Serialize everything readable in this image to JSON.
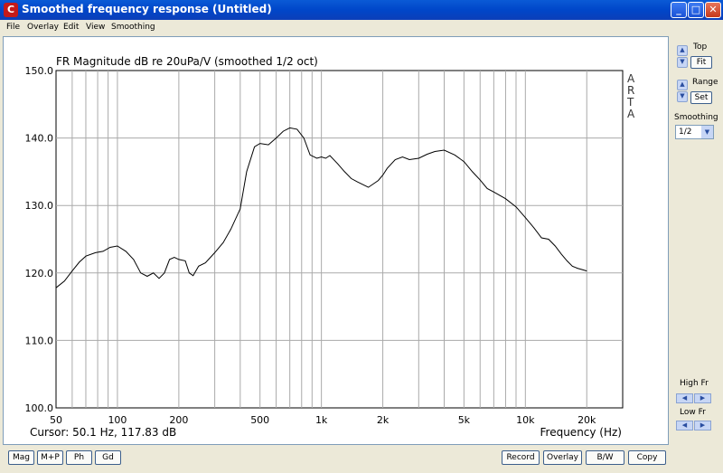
{
  "window": {
    "title": "Smoothed frequency response (Untitled)",
    "app_icon": "C",
    "minimize": "_",
    "maximize": "□",
    "close": "✕"
  },
  "menu": [
    "File",
    "Overlay",
    "Edit",
    "View",
    "Smoothing"
  ],
  "side_panel": {
    "top_label": "Top",
    "fit_label": "Fit",
    "range_label": "Range",
    "set_label": "Set",
    "smoothing_label": "Smoothing",
    "smoothing_value": "1/2",
    "high_fr_label": "High Fr",
    "low_fr_label": "Low Fr"
  },
  "bottom_left_buttons": [
    "Mag",
    "M+P",
    "Ph",
    "Gd"
  ],
  "bottom_right_buttons": [
    "Record",
    "Overlay",
    "B/W",
    "Copy"
  ],
  "colors": {
    "curve": "#000000",
    "grid": "#aaaaaa",
    "plot_bg": "#ffffff"
  },
  "chart_data": {
    "type": "line",
    "title": "FR Magnitude dB re 20uPa/V (smoothed 1/2 oct)",
    "watermark": "ARTA",
    "xlabel": "Frequency (Hz)",
    "x_scale": "log",
    "xlim": [
      50,
      30000
    ],
    "ylim": [
      100,
      150
    ],
    "yticks": [
      100,
      110,
      120,
      130,
      140,
      150
    ],
    "ytick_labels": [
      "100.0",
      "110.0",
      "120.0",
      "130.0",
      "140.0",
      "150.0"
    ],
    "xticks": [
      50,
      100,
      200,
      500,
      1000,
      2000,
      5000,
      10000,
      20000
    ],
    "xtick_labels": [
      "50",
      "100",
      "200",
      "500",
      "1k",
      "2k",
      "5k",
      "10k",
      "20k"
    ],
    "cursor_text": "Cursor: 50.1 Hz, 117.83 dB",
    "grid": true,
    "series": [
      {
        "x": [
          50,
          55,
          60,
          65,
          70,
          78,
          85,
          92,
          100,
          110,
          120,
          130,
          140,
          150,
          160,
          170,
          180,
          190,
          200,
          215,
          225,
          235,
          250,
          270,
          300,
          330,
          360,
          400,
          430,
          470,
          500,
          550,
          600,
          650,
          700,
          760,
          820,
          880,
          950,
          1000,
          1050,
          1100,
          1200,
          1300,
          1400,
          1500,
          1700,
          1900,
          2000,
          2100,
          2300,
          2500,
          2700,
          3000,
          3300,
          3600,
          4000,
          4500,
          5000,
          5500,
          6000,
          6500,
          7000,
          8000,
          9000,
          10000,
          11000,
          12000,
          13000,
          14000,
          15000,
          16000,
          17000,
          18000,
          19000,
          20000
        ],
        "y": [
          117.8,
          118.8,
          120.3,
          121.6,
          122.5,
          123.0,
          123.2,
          123.8,
          124.0,
          123.2,
          122.0,
          120.0,
          119.5,
          120.0,
          119.2,
          120.0,
          122.0,
          122.3,
          122.0,
          121.8,
          120.0,
          119.6,
          121.0,
          121.5,
          123.0,
          124.5,
          126.5,
          129.5,
          135.0,
          138.7,
          139.2,
          139.0,
          140.0,
          141.0,
          141.5,
          141.3,
          140.0,
          137.5,
          137.0,
          137.2,
          137.0,
          137.4,
          136.2,
          135.0,
          134.0,
          133.5,
          132.7,
          133.7,
          134.5,
          135.5,
          136.8,
          137.2,
          136.8,
          137.0,
          137.6,
          138.0,
          138.2,
          137.5,
          136.5,
          135.0,
          133.8,
          132.5,
          132.0,
          131.0,
          129.8,
          128.2,
          126.7,
          125.2,
          125.0,
          124.0,
          122.8,
          121.8,
          121.0,
          120.7,
          120.5,
          120.3
        ]
      }
    ]
  }
}
